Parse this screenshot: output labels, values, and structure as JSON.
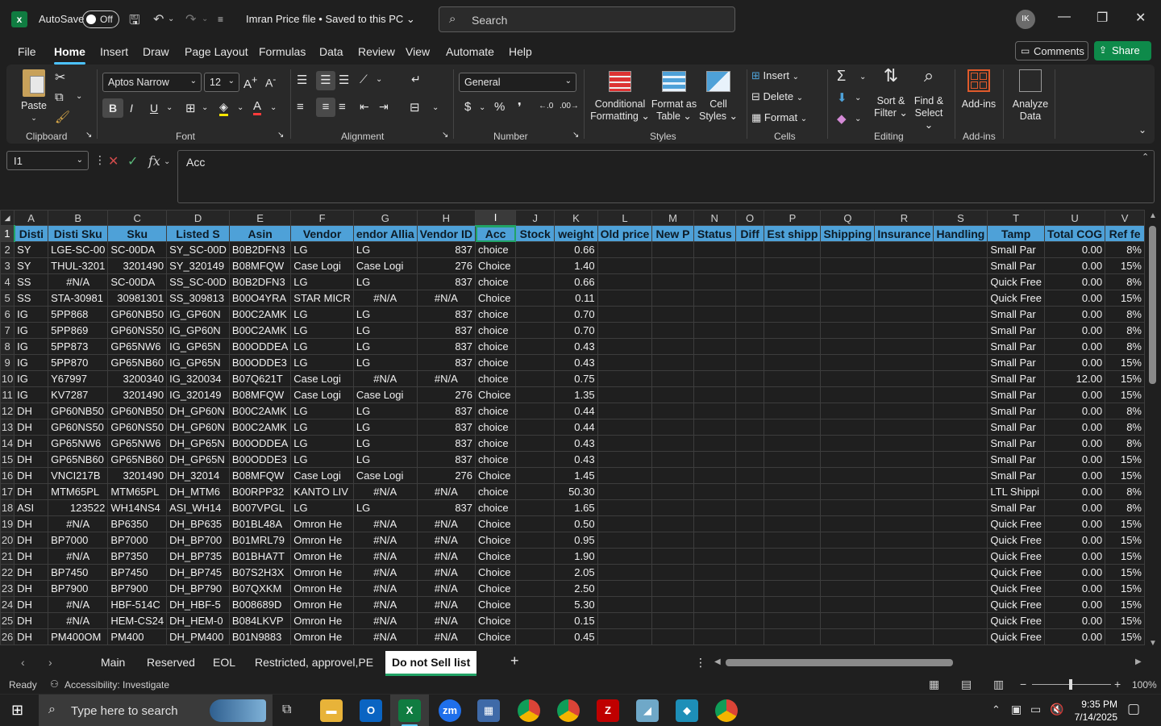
{
  "titlebar": {
    "autosave_label": "AutoSave",
    "autosave_state": "Off",
    "file_title": "Imran Price file • Saved to this PC ⌄",
    "search_placeholder": "Search",
    "avatar_initials": "IK"
  },
  "menu": {
    "tabs": [
      "File",
      "Home",
      "Insert",
      "Draw",
      "Page Layout",
      "Formulas",
      "Data",
      "Review",
      "View",
      "Automate",
      "Help"
    ],
    "active": "Home",
    "comments": "Comments",
    "share": "Share"
  },
  "ribbon": {
    "clipboard": {
      "paste": "Paste",
      "label": "Clipboard"
    },
    "font": {
      "name": "Aptos Narrow",
      "size": "12",
      "label": "Font"
    },
    "alignment": {
      "label": "Alignment"
    },
    "number": {
      "format": "General",
      "label": "Number"
    },
    "styles": {
      "conditional": [
        "Conditional",
        "Formatting ⌄"
      ],
      "format_table": [
        "Format as",
        "Table ⌄"
      ],
      "cell_styles": [
        "Cell",
        "Styles ⌄"
      ],
      "label": "Styles"
    },
    "cells": {
      "insert": "Insert",
      "delete": "Delete",
      "format": "Format",
      "label": "Cells"
    },
    "editing": {
      "sort": [
        "Sort &",
        "Filter ⌄"
      ],
      "find": [
        "Find &",
        "Select ⌄"
      ],
      "label": "Editing"
    },
    "addins": {
      "addins": "Add-ins",
      "label": "Add-ins"
    },
    "analyze": [
      "Analyze",
      "Data"
    ]
  },
  "formula_bar": {
    "name_box": "I1",
    "formula": "Acc"
  },
  "sheet": {
    "columns": [
      "A",
      "B",
      "C",
      "D",
      "E",
      "F",
      "G",
      "H",
      "I",
      "J",
      "K",
      "L",
      "M",
      "N",
      "O",
      "P",
      "Q",
      "R",
      "S",
      "T",
      "U",
      "V"
    ],
    "headers": [
      "Disti",
      "Disti Sku",
      "Sku",
      "Listed S",
      "Asin",
      "Vendor",
      "endor Allia",
      "Vendor ID",
      "Acc",
      "Stock",
      "weight",
      "Old price",
      "New P",
      "Status",
      "Diff",
      "Est shipp",
      "Shipping",
      "Insurance",
      "Handling",
      "Tamp",
      "Total COG",
      "Ref fe"
    ],
    "rows": [
      [
        "SY",
        "LGE-SC-00",
        "SC-00DA",
        "SY_SC-00D",
        "B0B2DFN3",
        "LG",
        "LG",
        "837",
        "choice",
        "",
        "0.66",
        "",
        "",
        "",
        "",
        "",
        "",
        "",
        "",
        "Small Par",
        "0.00",
        "8%"
      ],
      [
        "SY",
        "THUL-3201",
        "3201490",
        "SY_320149",
        "B08MFQW",
        "Case Logi",
        "Case Logi",
        "276",
        "Choice",
        "",
        "1.40",
        "",
        "",
        "",
        "",
        "",
        "",
        "",
        "",
        "Small Par",
        "0.00",
        "15%"
      ],
      [
        "SS",
        "#N/A",
        "SC-00DA",
        "SS_SC-00D",
        "B0B2DFN3",
        "LG",
        "LG",
        "837",
        "choice",
        "",
        "0.66",
        "",
        "",
        "",
        "",
        "",
        "",
        "",
        "",
        "Quick Free",
        "0.00",
        "8%"
      ],
      [
        "SS",
        "STA-30981",
        "30981301",
        "SS_309813",
        "B00O4YRA",
        "STAR MICR",
        "#N/A",
        "#N/A",
        "Choice",
        "",
        "0.11",
        "",
        "",
        "",
        "",
        "",
        "",
        "",
        "",
        "Quick Free",
        "0.00",
        "15%"
      ],
      [
        "IG",
        "5PP868",
        "GP60NB50",
        "IG_GP60N",
        "B00C2AMK",
        "LG",
        "LG",
        "837",
        "choice",
        "",
        "0.70",
        "",
        "",
        "",
        "",
        "",
        "",
        "",
        "",
        "Small Par",
        "0.00",
        "8%"
      ],
      [
        "IG",
        "5PP869",
        "GP60NS50",
        "IG_GP60N",
        "B00C2AMK",
        "LG",
        "LG",
        "837",
        "choice",
        "",
        "0.70",
        "",
        "",
        "",
        "",
        "",
        "",
        "",
        "",
        "Small Par",
        "0.00",
        "8%"
      ],
      [
        "IG",
        "5PP873",
        "GP65NW6",
        "IG_GP65N",
        "B00ODDEA",
        "LG",
        "LG",
        "837",
        "choice",
        "",
        "0.43",
        "",
        "",
        "",
        "",
        "",
        "",
        "",
        "",
        "Small Par",
        "0.00",
        "8%"
      ],
      [
        "IG",
        "5PP870",
        "GP65NB60",
        "IG_GP65N",
        "B00ODDE3",
        "LG",
        "LG",
        "837",
        "choice",
        "",
        "0.43",
        "",
        "",
        "",
        "",
        "",
        "",
        "",
        "",
        "Small Par",
        "0.00",
        "15%"
      ],
      [
        "IG",
        "Y67997",
        "3200340",
        "IG_320034",
        "B07Q621T",
        "Case Logi",
        "#N/A",
        "#N/A",
        "choice",
        "",
        "0.75",
        "",
        "",
        "",
        "",
        "",
        "",
        "",
        "",
        "Small Par",
        "12.00",
        "15%"
      ],
      [
        "IG",
        "KV7287",
        "3201490",
        "IG_320149",
        "B08MFQW",
        "Case Logi",
        "Case Logi",
        "276",
        "Choice",
        "",
        "1.35",
        "",
        "",
        "",
        "",
        "",
        "",
        "",
        "",
        "Small Par",
        "0.00",
        "15%"
      ],
      [
        "DH",
        "GP60NB50",
        "GP60NB50",
        "DH_GP60N",
        "B00C2AMK",
        "LG",
        "LG",
        "837",
        "choice",
        "",
        "0.44",
        "",
        "",
        "",
        "",
        "",
        "",
        "",
        "",
        "Small Par",
        "0.00",
        "8%"
      ],
      [
        "DH",
        "GP60NS50",
        "GP60NS50",
        "DH_GP60N",
        "B00C2AMK",
        "LG",
        "LG",
        "837",
        "choice",
        "",
        "0.44",
        "",
        "",
        "",
        "",
        "",
        "",
        "",
        "",
        "Small Par",
        "0.00",
        "8%"
      ],
      [
        "DH",
        "GP65NW6",
        "GP65NW6",
        "DH_GP65N",
        "B00ODDEA",
        "LG",
        "LG",
        "837",
        "choice",
        "",
        "0.43",
        "",
        "",
        "",
        "",
        "",
        "",
        "",
        "",
        "Small Par",
        "0.00",
        "8%"
      ],
      [
        "DH",
        "GP65NB60",
        "GP65NB60",
        "DH_GP65N",
        "B00ODDE3",
        "LG",
        "LG",
        "837",
        "choice",
        "",
        "0.43",
        "",
        "",
        "",
        "",
        "",
        "",
        "",
        "",
        "Small Par",
        "0.00",
        "15%"
      ],
      [
        "DH",
        "VNCI217B",
        "3201490",
        "DH_32014",
        "B08MFQW",
        "Case Logi",
        "Case Logi",
        "276",
        "Choice",
        "",
        "1.45",
        "",
        "",
        "",
        "",
        "",
        "",
        "",
        "",
        "Small Par",
        "0.00",
        "15%"
      ],
      [
        "DH",
        "MTM65PL",
        "MTM65PL",
        "DH_MTM6",
        "B00RPP32",
        "KANTO LIV",
        "#N/A",
        "#N/A",
        "choice",
        "",
        "50.30",
        "",
        "",
        "",
        "",
        "",
        "",
        "",
        "",
        "LTL Shippi",
        "0.00",
        "8%"
      ],
      [
        "ASI",
        "123522",
        "WH14NS4",
        "ASI_WH14",
        "B007VPGL",
        "LG",
        "LG",
        "837",
        "choice",
        "",
        "1.65",
        "",
        "",
        "",
        "",
        "",
        "",
        "",
        "",
        "Small Par",
        "0.00",
        "8%"
      ],
      [
        "DH",
        "#N/A",
        "BP6350",
        "DH_BP635",
        "B01BL48A",
        "Omron He",
        "#N/A",
        "#N/A",
        "Choice",
        "",
        "0.50",
        "",
        "",
        "",
        "",
        "",
        "",
        "",
        "",
        "Quick Free",
        "0.00",
        "15%"
      ],
      [
        "DH",
        "BP7000",
        "BP7000",
        "DH_BP700",
        "B01MRL79",
        "Omron He",
        "#N/A",
        "#N/A",
        "Choice",
        "",
        "0.95",
        "",
        "",
        "",
        "",
        "",
        "",
        "",
        "",
        "Quick Free",
        "0.00",
        "15%"
      ],
      [
        "DH",
        "#N/A",
        "BP7350",
        "DH_BP735",
        "B01BHA7T",
        "Omron He",
        "#N/A",
        "#N/A",
        "Choice",
        "",
        "1.90",
        "",
        "",
        "",
        "",
        "",
        "",
        "",
        "",
        "Quick Free",
        "0.00",
        "15%"
      ],
      [
        "DH",
        "BP7450",
        "BP7450",
        "DH_BP745",
        "B07S2H3X",
        "Omron He",
        "#N/A",
        "#N/A",
        "Choice",
        "",
        "2.05",
        "",
        "",
        "",
        "",
        "",
        "",
        "",
        "",
        "Quick Free",
        "0.00",
        "15%"
      ],
      [
        "DH",
        "BP7900",
        "BP7900",
        "DH_BP790",
        "B07QXKM",
        "Omron He",
        "#N/A",
        "#N/A",
        "Choice",
        "",
        "2.50",
        "",
        "",
        "",
        "",
        "",
        "",
        "",
        "",
        "Quick Free",
        "0.00",
        "15%"
      ],
      [
        "DH",
        "#N/A",
        "HBF-514C",
        "DH_HBF-5",
        "B008689D",
        "Omron He",
        "#N/A",
        "#N/A",
        "Choice",
        "",
        "5.30",
        "",
        "",
        "",
        "",
        "",
        "",
        "",
        "",
        "Quick Free",
        "0.00",
        "15%"
      ],
      [
        "DH",
        "#N/A",
        "HEM-CS24",
        "DH_HEM-0",
        "B084LKVP",
        "Omron He",
        "#N/A",
        "#N/A",
        "Choice",
        "",
        "0.15",
        "",
        "",
        "",
        "",
        "",
        "",
        "",
        "",
        "Quick Free",
        "0.00",
        "15%"
      ],
      [
        "DH",
        "PM400OM",
        "PM400",
        "DH_PM400",
        "B01N9883",
        "Omron He",
        "#N/A",
        "#N/A",
        "Choice",
        "",
        "0.45",
        "",
        "",
        "",
        "",
        "",
        "",
        "",
        "",
        "Quick Free",
        "0.00",
        "15%"
      ]
    ]
  },
  "sheet_tabs": [
    "Main",
    "Reserved",
    "EOL",
    "Restricted, approvel,PE",
    "Do not Sell list"
  ],
  "active_sheet": "Do not Sell list",
  "status": {
    "ready": "Ready",
    "accessibility": "Accessibility: Investigate",
    "zoom": "100%"
  },
  "taskbar": {
    "search_placeholder": "Type here to search",
    "time": "9:35 PM",
    "date": "7/14/2025"
  },
  "colors": {
    "header_fill": "#4ea1d8",
    "excel_green": "#21a366",
    "share_green": "#0e8a4a"
  }
}
